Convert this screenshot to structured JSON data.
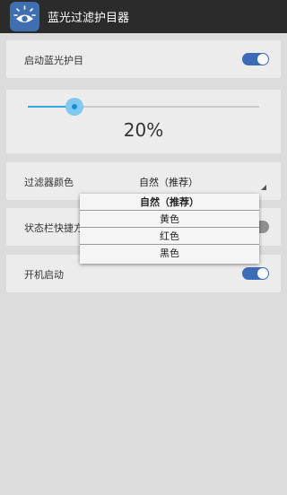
{
  "app": {
    "title": "蓝光过滤护目器"
  },
  "rows": {
    "enable": {
      "label": "启动蓝光护目",
      "on": true
    },
    "intensity": {
      "percent_label": "20%",
      "value": 0.2
    },
    "filter": {
      "label": "过滤器颜色",
      "value": "自然（推荐）"
    },
    "statusbar": {
      "label": "状态栏快捷方",
      "on": false
    },
    "boot": {
      "label": "开机启动",
      "on": true
    }
  },
  "dropdown": {
    "options": [
      "自然（推荐）",
      "黄色",
      "红色",
      "黑色"
    ],
    "selected": "自然（推荐）"
  },
  "colors": {
    "accent": "#3d6bb8",
    "slider": "#33a9e0",
    "toggle_off": "#8f8f8f",
    "titlebar": "#2b2b2b"
  }
}
